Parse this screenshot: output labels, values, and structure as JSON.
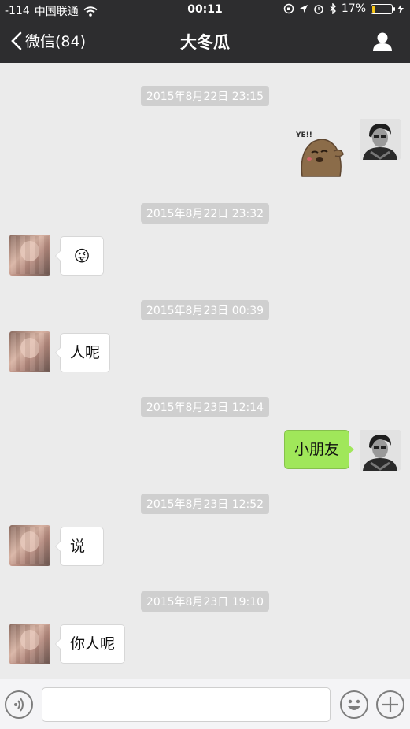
{
  "status_bar": {
    "signal": "-114",
    "carrier": "中国联通",
    "time": "00:11",
    "battery": "17%",
    "battery_level": 0.17
  },
  "nav": {
    "back_label": "微信(84)",
    "title": "大冬瓜"
  },
  "messages": [
    {
      "timestamp": "2015年8月22日 23:15",
      "side": "right",
      "type": "sticker",
      "sticker_text": "YE!!"
    },
    {
      "timestamp": "2015年8月22日 23:32",
      "side": "left",
      "type": "emoji",
      "emoji": "😜"
    },
    {
      "timestamp": "2015年8月23日 00:39",
      "side": "left",
      "type": "text",
      "text": "人呢"
    },
    {
      "timestamp": "2015年8月23日 12:14",
      "side": "right",
      "type": "text",
      "text": "小朋友"
    },
    {
      "timestamp": "2015年8月23日 12:52",
      "side": "left",
      "type": "text",
      "text": "说"
    },
    {
      "timestamp": "2015年8月23日 19:10",
      "side": "left",
      "type": "text",
      "text": "你人呢"
    }
  ],
  "input_bar": {
    "voice_icon": "voice-icon",
    "emoji_icon": "emoji-icon",
    "plus_icon": "plus-icon",
    "placeholder": ""
  },
  "colors": {
    "nav_bg": "#2d2d2f",
    "chat_bg": "#ebebeb",
    "sent_bubble": "#a0e75a",
    "battery_fill": "#f5c518"
  }
}
